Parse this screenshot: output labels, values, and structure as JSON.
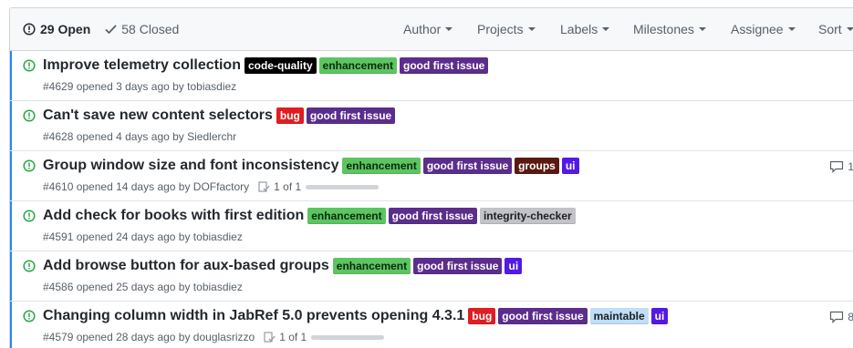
{
  "states": {
    "open": {
      "count": "29",
      "label": "Open"
    },
    "closed": {
      "count": "58",
      "label": "Closed"
    }
  },
  "filters": [
    "Author",
    "Projects",
    "Labels",
    "Milestones",
    "Assignee",
    "Sort"
  ],
  "label_colors": {
    "code-quality": {
      "bg": "#000000",
      "fg": "#ffffff"
    },
    "enhancement": {
      "bg": "#5cc562",
      "fg": "#0b2a0c"
    },
    "good first issue": {
      "bg": "#5b2d8c",
      "fg": "#ffffff"
    },
    "bug": {
      "bg": "#e11d21",
      "fg": "#ffffff"
    },
    "groups": {
      "bg": "#5a1a0f",
      "fg": "#ffffff"
    },
    "ui": {
      "bg": "#5319e7",
      "fg": "#ffffff"
    },
    "integrity-checker": {
      "bg": "#c2c2c8",
      "fg": "#1b1f23"
    },
    "maintable": {
      "bg": "#bfdef7",
      "fg": "#1b1f23"
    }
  },
  "issues": [
    {
      "title": "Improve telemetry collection",
      "labels": [
        "code-quality",
        "enhancement",
        "good first issue"
      ],
      "meta": "#4629 opened 3 days ago by tobiasdiez",
      "comments": "",
      "tasks": "",
      "task_progress": 0
    },
    {
      "title": "Can't save new content selectors",
      "labels": [
        "bug",
        "good first issue"
      ],
      "meta": "#4628 opened 4 days ago by Siedlerchr",
      "comments": "",
      "tasks": "",
      "task_progress": 0
    },
    {
      "title": "Group window size and font inconsistency",
      "labels": [
        "enhancement",
        "good first issue",
        "groups",
        "ui"
      ],
      "meta": "#4610 opened 14 days ago by DOFfactory",
      "comments": "1",
      "tasks": "1 of 1",
      "task_progress": 1
    },
    {
      "title": "Add check for books with first edition",
      "labels": [
        "enhancement",
        "good first issue",
        "integrity-checker"
      ],
      "meta": "#4591 opened 24 days ago by tobiasdiez",
      "comments": "",
      "tasks": "",
      "task_progress": 0
    },
    {
      "title": "Add browse button for aux-based groups",
      "labels": [
        "enhancement",
        "good first issue",
        "ui"
      ],
      "meta": "#4586 opened 25 days ago by tobiasdiez",
      "comments": "",
      "tasks": "",
      "task_progress": 0
    },
    {
      "title": "Changing column width in JabRef 5.0 prevents opening 4.3.1",
      "labels": [
        "bug",
        "good first issue",
        "maintable",
        "ui"
      ],
      "meta": "#4579 opened 28 days ago by douglasrizzo",
      "comments": "8",
      "tasks": "1 of 1",
      "task_progress": 1
    }
  ]
}
